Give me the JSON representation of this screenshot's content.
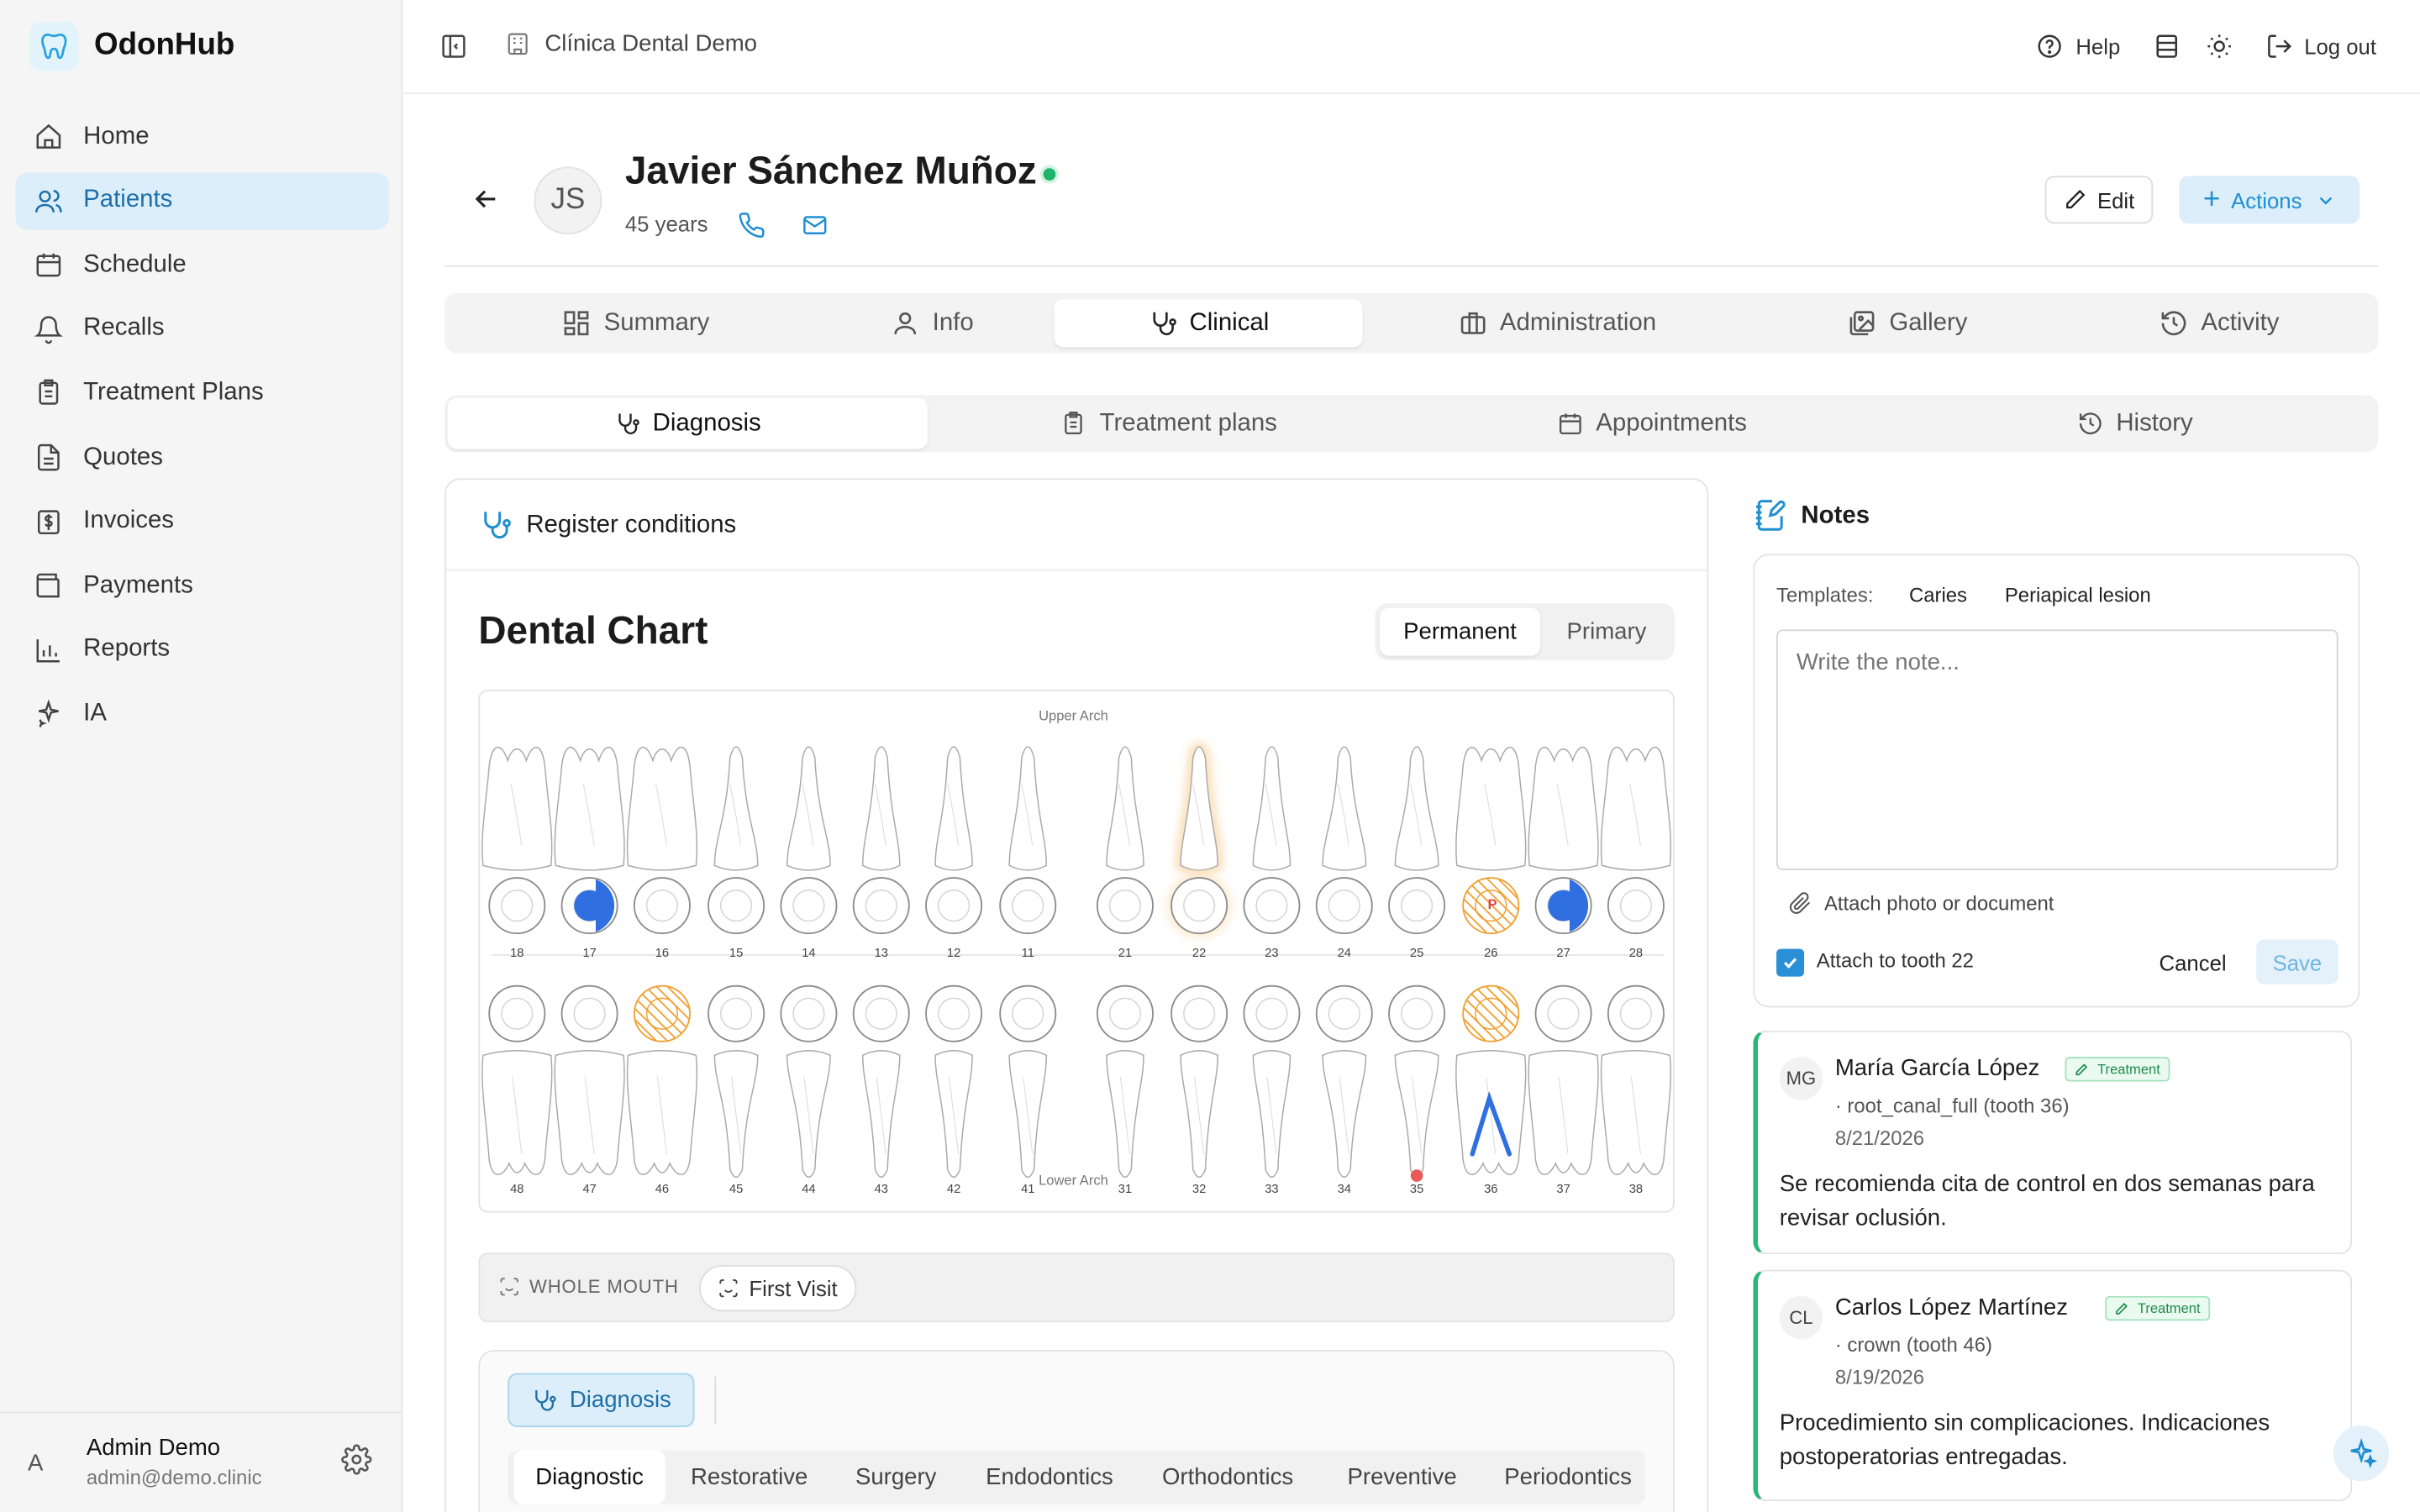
{
  "app": {
    "name": "OdonHub",
    "clinic": "Clínica Dental Demo"
  },
  "sidebar": {
    "items": [
      {
        "label": "Home",
        "icon": "home-icon"
      },
      {
        "label": "Patients",
        "icon": "users-icon"
      },
      {
        "label": "Schedule",
        "icon": "calendar-icon"
      },
      {
        "label": "Recalls",
        "icon": "bell-icon"
      },
      {
        "label": "Treatment Plans",
        "icon": "clipboard-icon"
      },
      {
        "label": "Quotes",
        "icon": "file-icon"
      },
      {
        "label": "Invoices",
        "icon": "dollar-icon"
      },
      {
        "label": "Payments",
        "icon": "wallet-icon"
      },
      {
        "label": "Reports",
        "icon": "bar-chart-icon"
      },
      {
        "label": "IA",
        "icon": "sparkle-icon"
      }
    ],
    "active_index": 1
  },
  "user": {
    "initial": "A",
    "name": "Admin Demo",
    "email": "admin@demo.clinic"
  },
  "topbar": {
    "help": "Help",
    "logout": "Log out"
  },
  "patient": {
    "initials": "JS",
    "name": "Javier Sánchez Muñoz",
    "age": "45 years",
    "edit": "Edit",
    "actions": "Actions"
  },
  "tabs": [
    "Summary",
    "Info",
    "Clinical",
    "Administration",
    "Gallery",
    "Activity"
  ],
  "subtabs": [
    "Diagnosis",
    "Treatment plans",
    "Appointments",
    "History"
  ],
  "register": {
    "title": "Register conditions"
  },
  "chart": {
    "title": "Dental Chart",
    "toggle": [
      "Permanent",
      "Primary"
    ],
    "upper_label": "Upper Arch",
    "lower_label": "Lower Arch",
    "upper_teeth": [
      "18",
      "17",
      "16",
      "15",
      "14",
      "13",
      "12",
      "11",
      "21",
      "22",
      "23",
      "24",
      "25",
      "26",
      "27",
      "28"
    ],
    "lower_teeth": [
      "48",
      "47",
      "46",
      "45",
      "44",
      "43",
      "42",
      "41",
      "31",
      "32",
      "33",
      "34",
      "35",
      "36",
      "37",
      "38"
    ],
    "marker_p": "P",
    "whole_mouth": "WHOLE MOUTH",
    "first_visit": "First Visit"
  },
  "diagnosis": {
    "button": "Diagnosis",
    "tabs": [
      "Diagnostic",
      "Restorative",
      "Surgery",
      "Endodontics",
      "Orthodontics",
      "Preventive",
      "Periodontics"
    ]
  },
  "notes": {
    "title": "Notes",
    "templates_label": "Templates:",
    "templates": [
      "Caries",
      "Periapical lesion"
    ],
    "placeholder": "Write the note...",
    "attach": "Attach photo or document",
    "attach_tooth": "Attach to tooth 22",
    "cancel": "Cancel",
    "save": "Save",
    "entries": [
      {
        "initials": "MG",
        "author": "María García López",
        "badge": "Treatment",
        "detail": "· root_canal_full (tooth 36)",
        "date": "8/21/2026",
        "text": "Se recomienda cita de control en dos semanas para revisar oclusión."
      },
      {
        "initials": "CL",
        "author": "Carlos López Martínez",
        "badge": "Treatment",
        "detail": "· crown (tooth 46)",
        "date": "8/19/2026",
        "text": "Procedimiento sin complicaciones. Indicaciones postoperatorias entregadas."
      }
    ]
  },
  "colors": {
    "accent": "#1f8fd0",
    "active_bg": "#dbeefa",
    "treatment_orange": "#f0a030",
    "filling_blue": "#2f6fe0",
    "online": "#1fb36b"
  }
}
